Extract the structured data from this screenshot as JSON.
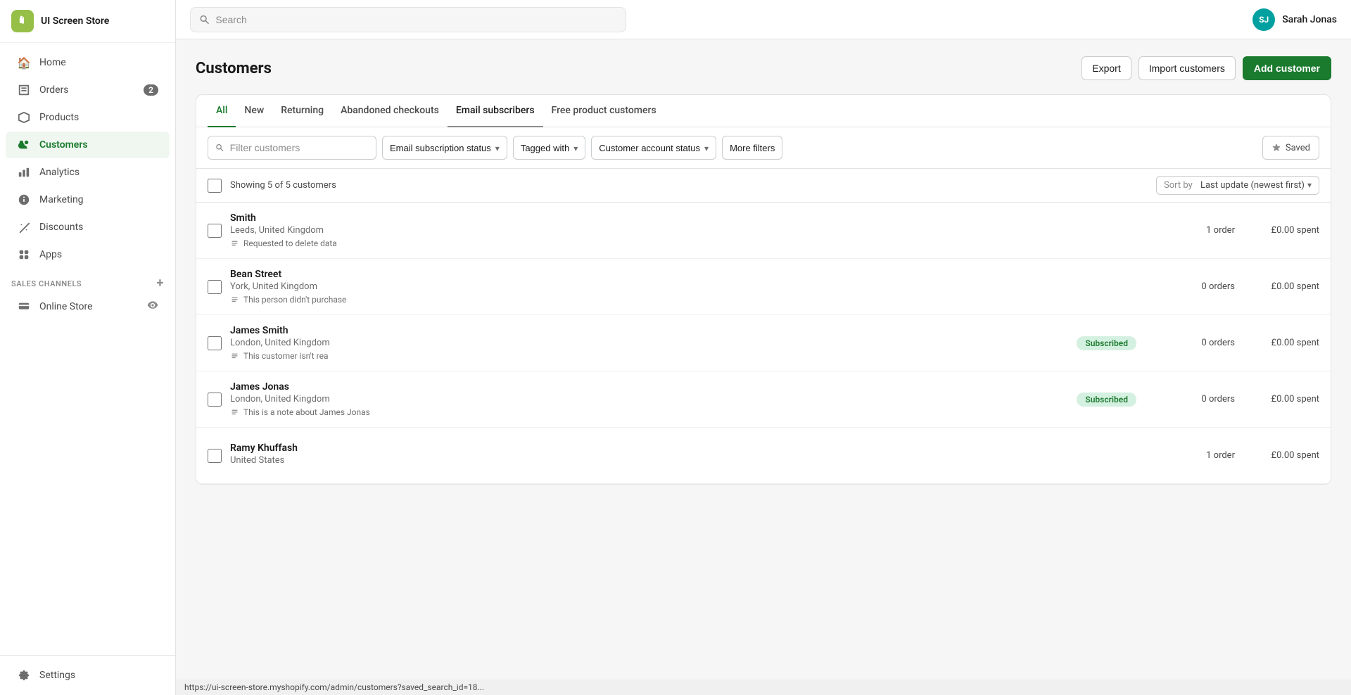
{
  "store": {
    "logo_initials": "S",
    "name": "UI Screen Store"
  },
  "topbar": {
    "search_placeholder": "Search",
    "user_initials": "SJ",
    "user_name": "Sarah Jonas"
  },
  "sidebar": {
    "nav_items": [
      {
        "id": "home",
        "label": "Home",
        "icon": "🏠",
        "badge": null
      },
      {
        "id": "orders",
        "label": "Orders",
        "icon": "📋",
        "badge": "2"
      },
      {
        "id": "products",
        "label": "Products",
        "icon": "🏷️",
        "badge": null
      },
      {
        "id": "customers",
        "label": "Customers",
        "icon": "👥",
        "badge": null,
        "active": true
      },
      {
        "id": "analytics",
        "label": "Analytics",
        "icon": "📊",
        "badge": null
      },
      {
        "id": "marketing",
        "label": "Marketing",
        "icon": "📣",
        "badge": null
      },
      {
        "id": "discounts",
        "label": "Discounts",
        "icon": "🏷",
        "badge": null
      },
      {
        "id": "apps",
        "label": "Apps",
        "icon": "🔧",
        "badge": null
      }
    ],
    "sales_channels_label": "SALES CHANNELS",
    "sales_channels": [
      {
        "id": "online-store",
        "label": "Online Store"
      }
    ],
    "settings_label": "Settings"
  },
  "page": {
    "title": "Customers",
    "export_label": "Export",
    "import_label": "Import customers",
    "add_label": "Add customer"
  },
  "tabs": [
    {
      "id": "all",
      "label": "All",
      "active": true
    },
    {
      "id": "new",
      "label": "New"
    },
    {
      "id": "returning",
      "label": "Returning"
    },
    {
      "id": "abandoned",
      "label": "Abandoned checkouts"
    },
    {
      "id": "email-subscribers",
      "label": "Email subscribers"
    },
    {
      "id": "free-product",
      "label": "Free product customers"
    }
  ],
  "filters": {
    "search_placeholder": "Filter customers",
    "email_status_label": "Email subscription status",
    "tagged_with_label": "Tagged with",
    "account_status_label": "Customer account status",
    "more_filters_label": "More filters",
    "saved_label": "Saved"
  },
  "table": {
    "showing_text": "Showing 5 of 5 customers",
    "sort_prefix": "Sort by",
    "sort_value": "Last update (newest first)",
    "customers": [
      {
        "id": "smith",
        "name": "Smith",
        "location": "Leeds, United Kingdom",
        "note": "Requested to delete data",
        "status_badge": null,
        "orders": "1 order",
        "spent": "£0.00 spent"
      },
      {
        "id": "bean-street",
        "name": "Bean Street",
        "location": "York, United Kingdom",
        "note": "This person didn't purchase",
        "status_badge": null,
        "orders": "0 orders",
        "spent": "£0.00 spent"
      },
      {
        "id": "james-smith",
        "name": "James Smith",
        "location": "London, United Kingdom",
        "note": "This customer isn't rea",
        "status_badge": "Subscribed",
        "orders": "0 orders",
        "spent": "£0.00 spent"
      },
      {
        "id": "james-jonas",
        "name": "James Jonas",
        "location": "London, United Kingdom",
        "note": "This is a note about James Jonas",
        "status_badge": "Subscribed",
        "orders": "0 orders",
        "spent": "£0.00 spent"
      },
      {
        "id": "ramy-khuffash",
        "name": "Ramy Khuffash",
        "location": "United States",
        "note": "",
        "status_badge": null,
        "orders": "1 order",
        "spent": "£0.00 spent"
      }
    ]
  },
  "statusbar": {
    "url": "https://ui-screen-store.myshopify.com/admin/customers?saved_search_id=18..."
  }
}
